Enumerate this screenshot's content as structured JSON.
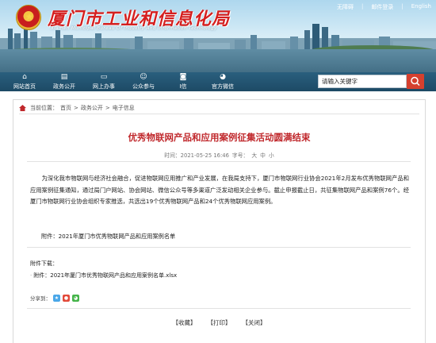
{
  "header": {
    "site_title": "厦门市工业和信息化局",
    "site_subtitle": "Xiamen Municipal Bureau Of Industry And Information Technology",
    "top_links": [
      "无障碍",
      "|",
      "邮件登录",
      "|",
      "English"
    ]
  },
  "nav": {
    "items": [
      {
        "label": "网站首页",
        "icon": "home-icon"
      },
      {
        "label": "政务公开",
        "icon": "document-icon"
      },
      {
        "label": "网上办事",
        "icon": "monitor-icon"
      },
      {
        "label": "公众参与",
        "icon": "people-icon"
      },
      {
        "label": "I信",
        "icon": "chat-icon"
      },
      {
        "label": "官方微信",
        "icon": "wechat-icon"
      }
    ],
    "search_value": "请输入关键字"
  },
  "breadcrumb": {
    "prefix": "当前位置：",
    "items": [
      "首页",
      "政务公开",
      "电子信息"
    ],
    "sep": ">"
  },
  "article": {
    "title": "优秀物联网产品和应用案例征集活动圆满结束",
    "time_label": "时间：2021-05-25 16:46",
    "font_size_label": "字号：",
    "font_sizes": [
      "大",
      "中",
      "小"
    ],
    "body": "为深化我市物联网与经济社会融合，促进物联网应用推广和产业发展，在我局支持下，厦门市物联网行业协会2021年2月发布优秀物联网产品和应用案例征集通知，通过局门户网站、协会网站、微信公众号等多渠道广泛发动相关企业参与。截止申报截止日，共征集物联网产品和案例76个。经厦门市物联网行业协会组织专家推选，共选出19个优秀物联网产品和24个优秀物联网应用案例。",
    "attachment_line": "附件：2021年厦门市优秀物联网产品和应用案例名单",
    "downloads_label": "附件下载：",
    "downloads": [
      "附件：2021年厦门市优秀物联网产品和应用案例名单.xlsx"
    ]
  },
  "share": {
    "label": "分享到："
  },
  "actions": [
    "【收藏】",
    "【打印】",
    "【关闭】"
  ]
}
